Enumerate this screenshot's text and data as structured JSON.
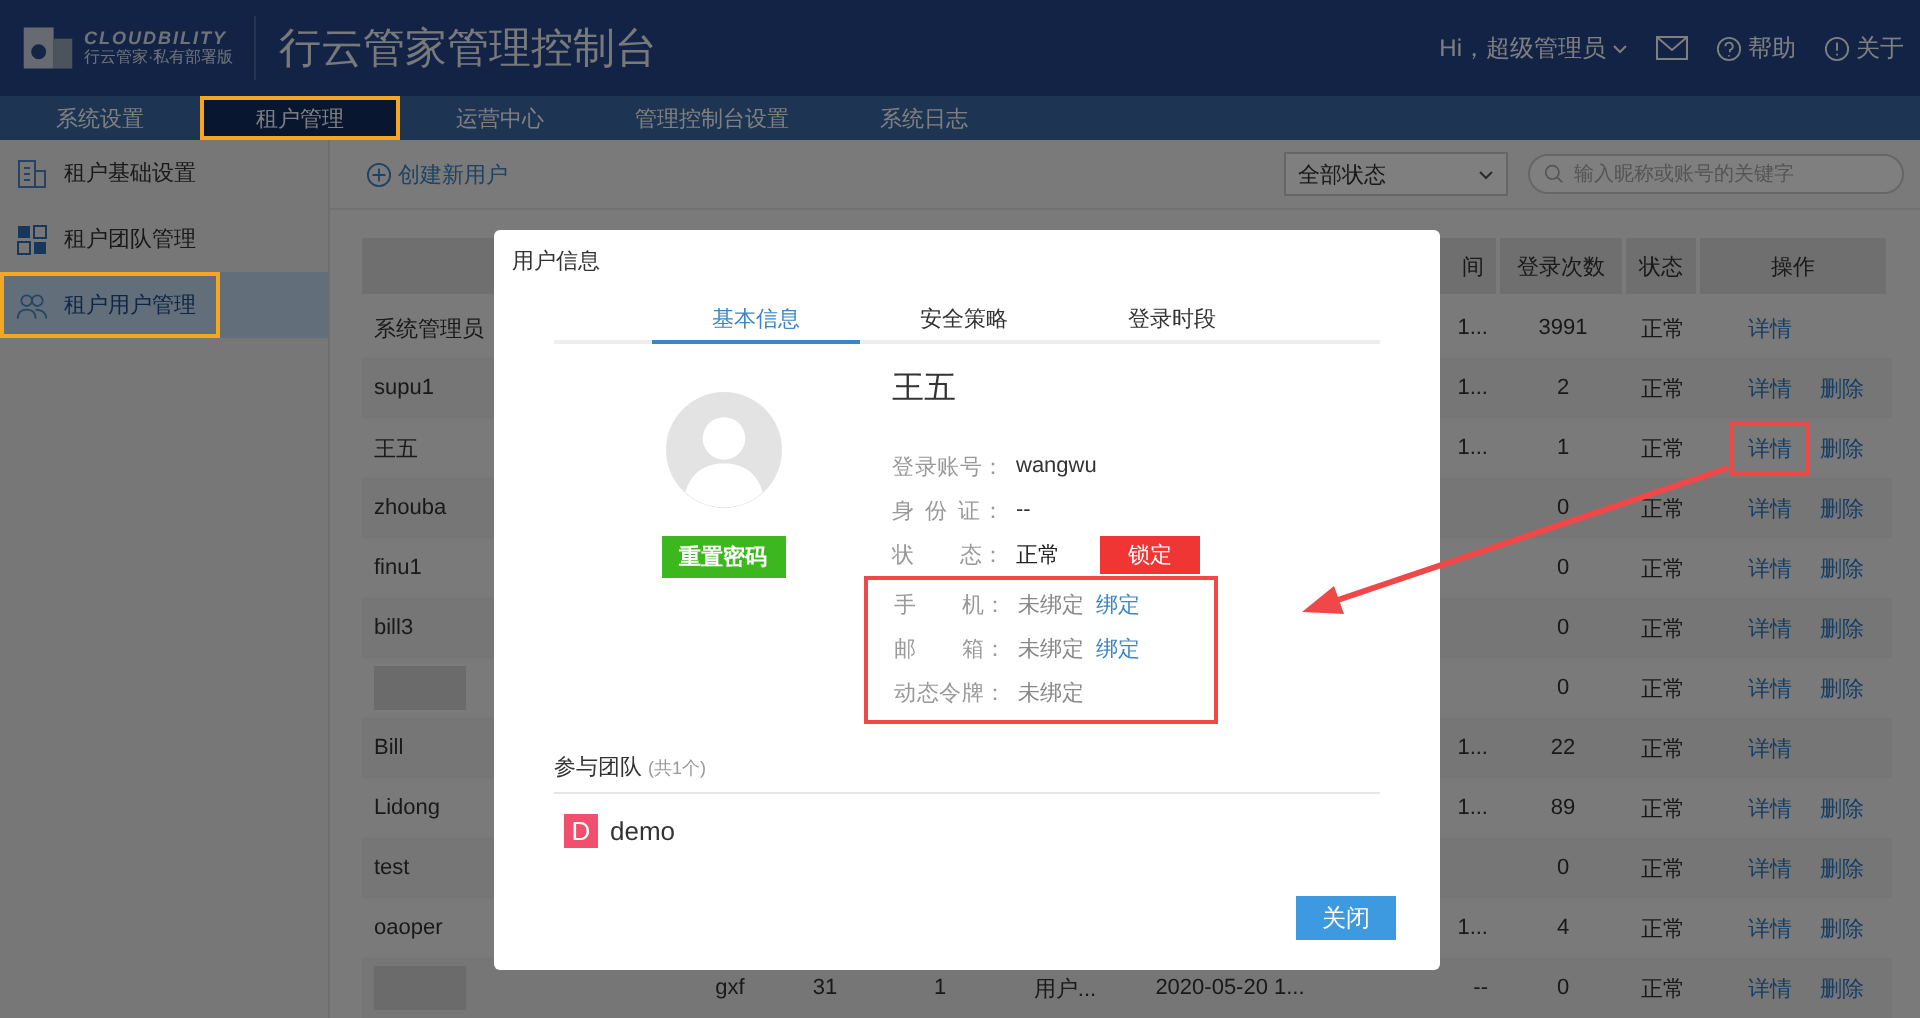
{
  "header": {
    "logo_en": "CLOUDBILITY",
    "logo_cn": "行云管家·私有部署版",
    "title": "行云管家管理控制台",
    "greeting": "Hi，超级管理员",
    "help": "帮助",
    "about": "关于"
  },
  "nav": [
    {
      "label": "系统设置",
      "selected": false,
      "annotated": false
    },
    {
      "label": "租户管理",
      "selected": true,
      "annotated": true
    },
    {
      "label": "运营中心",
      "selected": false,
      "annotated": false
    },
    {
      "label": "管理控制台设置",
      "selected": false,
      "annotated": false
    },
    {
      "label": "系统日志",
      "selected": false,
      "annotated": false
    }
  ],
  "sidebar": {
    "items": [
      {
        "label": "租户基础设置",
        "selected": false,
        "annotated": false
      },
      {
        "label": "租户团队管理",
        "selected": false,
        "annotated": false
      },
      {
        "label": "租户用户管理",
        "selected": true,
        "annotated": true
      }
    ]
  },
  "toolbar": {
    "create": "创建新用户",
    "status_filter": "全部状态",
    "search": {
      "placeholder": "输入昵称或账号的关键字"
    }
  },
  "table": {
    "columns": [
      "间",
      "登录次数",
      "状态",
      "操作"
    ],
    "rows": [
      {
        "name": "系统管理员",
        "blurred": false,
        "c7": "1...",
        "c8": "3991",
        "c9": "正常",
        "actions": [
          {
            "label": "详情",
            "annotated": false
          }
        ]
      },
      {
        "name": "supu1",
        "blurred": false,
        "c7": "1...",
        "c8": "2",
        "c9": "正常",
        "actions": [
          {
            "label": "详情",
            "annotated": false
          },
          {
            "label": "删除",
            "annotated": false
          }
        ]
      },
      {
        "name": "王五",
        "blurred": false,
        "c7": "1...",
        "c8": "1",
        "c9": "正常",
        "actions": [
          {
            "label": "详情",
            "annotated": true
          },
          {
            "label": "删除",
            "annotated": false
          }
        ]
      },
      {
        "name": "zhouba",
        "blurred": false,
        "c8": "0",
        "c9": "正常",
        "actions": [
          {
            "label": "详情",
            "annotated": false
          },
          {
            "label": "删除",
            "annotated": false
          }
        ]
      },
      {
        "name": "finu1",
        "blurred": false,
        "c8": "0",
        "c9": "正常",
        "actions": [
          {
            "label": "详情",
            "annotated": false
          },
          {
            "label": "删除",
            "annotated": false
          }
        ]
      },
      {
        "name": "bill3",
        "blurred": false,
        "c8": "0",
        "c9": "正常",
        "actions": [
          {
            "label": "详情",
            "annotated": false
          },
          {
            "label": "删除",
            "annotated": false
          }
        ]
      },
      {
        "blurred": true,
        "c8": "0",
        "c9": "正常",
        "actions": [
          {
            "label": "详情",
            "annotated": false
          },
          {
            "label": "删除",
            "annotated": false
          }
        ]
      },
      {
        "name": "Bill",
        "blurred": false,
        "c7": "1...",
        "c8": "22",
        "c9": "正常",
        "actions": [
          {
            "label": "详情",
            "annotated": false
          }
        ]
      },
      {
        "name": "Lidong",
        "blurred": false,
        "c7": "1...",
        "c8": "89",
        "c9": "正常",
        "actions": [
          {
            "label": "详情",
            "annotated": false
          },
          {
            "label": "删除",
            "annotated": false
          }
        ]
      },
      {
        "name": "test",
        "blurred": false,
        "c8": "0",
        "c9": "正常",
        "actions": [
          {
            "label": "详情",
            "annotated": false
          },
          {
            "label": "删除",
            "annotated": false
          }
        ]
      },
      {
        "name": "oaoper",
        "blurred": false,
        "c7": "1...",
        "c8": "4",
        "c9": "正常",
        "actions": [
          {
            "label": "详情",
            "annotated": false
          },
          {
            "label": "删除",
            "annotated": false
          }
        ]
      },
      {
        "blurred": true,
        "c2": "gxf",
        "c3": "31",
        "c4": "1",
        "c5": "用户...",
        "c6": "2020-05-20 1...",
        "c7": "--",
        "c8": "0",
        "c9": "正常",
        "actions": [
          {
            "label": "详情",
            "annotated": false
          },
          {
            "label": "删除",
            "annotated": false
          }
        ]
      }
    ]
  },
  "modal": {
    "title": "用户信息",
    "tabs": [
      {
        "label": "基本信息",
        "selected": true
      },
      {
        "label": "安全策略",
        "selected": false
      },
      {
        "label": "登录时段",
        "selected": false
      }
    ],
    "reset_button": "重置密码",
    "name": "王五",
    "fields": [
      {
        "kind": "text",
        "label": "登录账号：",
        "value": "wangwu"
      },
      {
        "kind": "text",
        "label": "身 份 证：",
        "value": "--"
      },
      {
        "kind": "status",
        "label": "状　　态：",
        "value": "正常",
        "button": "锁定"
      }
    ],
    "bindings": {
      "annotated": true,
      "items": [
        {
          "kind": "link",
          "label": "手　　机：",
          "value": "未绑定",
          "link": "绑定"
        },
        {
          "kind": "link",
          "label": "邮　　箱：",
          "value": "未绑定",
          "link": "绑定"
        },
        {
          "kind": "text",
          "label": "动态令牌：",
          "value": "未绑定"
        }
      ]
    },
    "teams_title": "参与团队",
    "teams_count": "(共1个)",
    "teams": [
      {
        "initial": "D",
        "name": "demo",
        "color": "#f0506e"
      }
    ],
    "close_button": "关闭"
  }
}
